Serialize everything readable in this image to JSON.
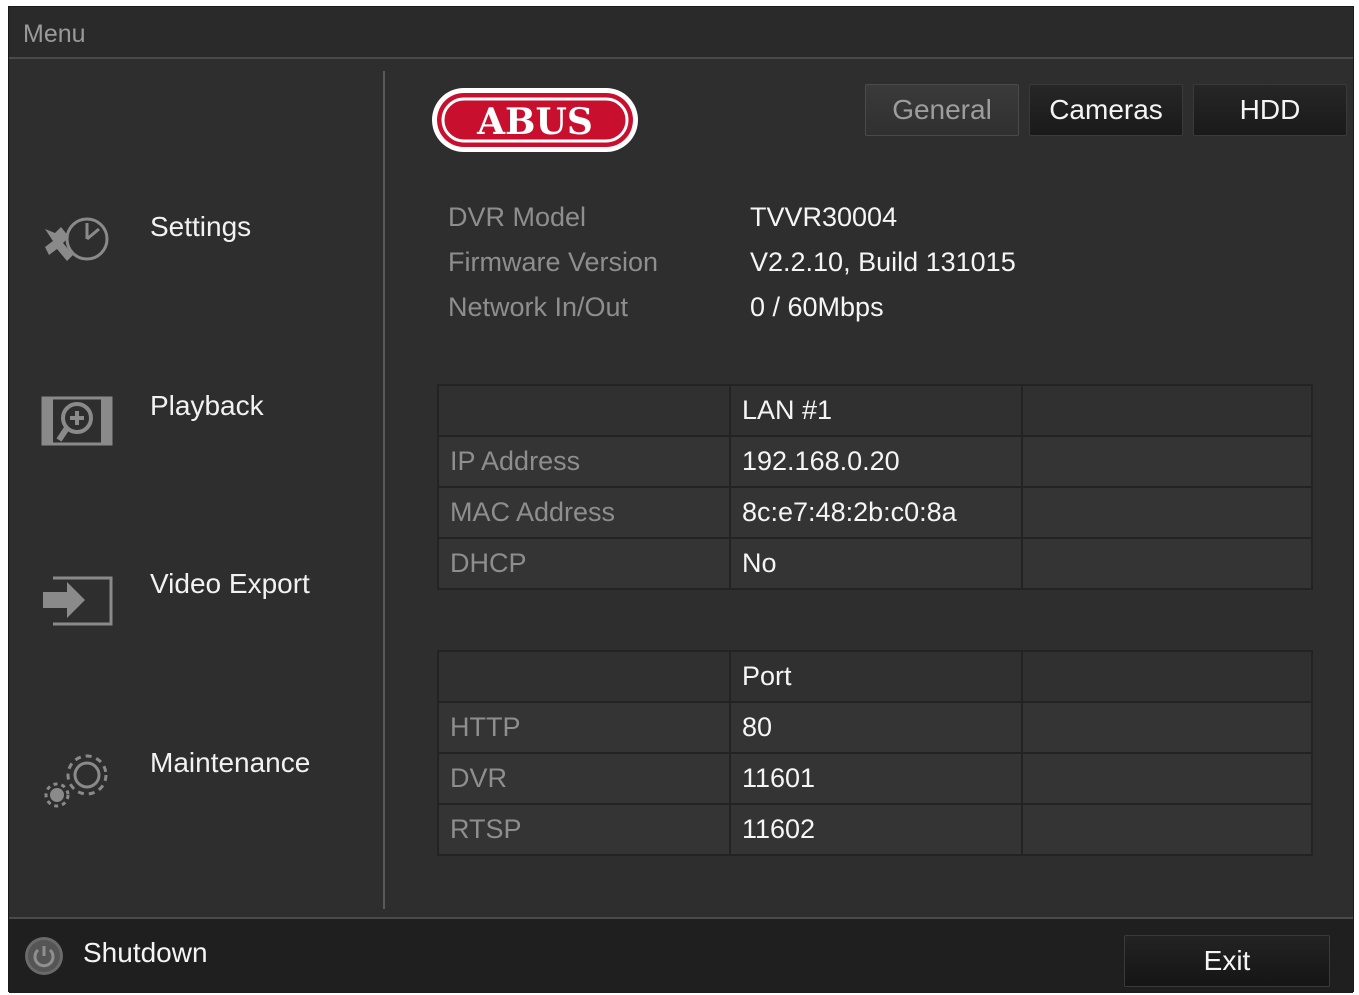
{
  "window": {
    "title": "Menu"
  },
  "brand": {
    "logo_text": "ABUS",
    "logo_color": "#c8102e"
  },
  "tabs": [
    {
      "label": "General",
      "active": true
    },
    {
      "label": "Cameras",
      "active": false
    },
    {
      "label": "HDD",
      "active": false
    }
  ],
  "sidebar": {
    "items": [
      {
        "label": "Settings",
        "icon": "settings-tools-icon"
      },
      {
        "label": "Playback",
        "icon": "playback-search-icon"
      },
      {
        "label": "Video Export",
        "icon": "video-export-icon"
      },
      {
        "label": "Maintenance",
        "icon": "maintenance-gears-icon"
      }
    ]
  },
  "info": {
    "dvr_model": {
      "label": "DVR Model",
      "value": "TVVR30004"
    },
    "firmware": {
      "label": "Firmware Version",
      "value": "V2.2.10, Build 131015"
    },
    "network": {
      "label": "Network In/Out",
      "value": "0 / 60Mbps"
    }
  },
  "lan_table": {
    "header": "LAN #1",
    "rows": [
      {
        "label": "IP Address",
        "value": "192.168.0.20"
      },
      {
        "label": "MAC Address",
        "value": "8c:e7:48:2b:c0:8a"
      },
      {
        "label": "DHCP",
        "value": "No"
      }
    ]
  },
  "port_table": {
    "header": "Port",
    "rows": [
      {
        "label": "HTTP",
        "value": "80"
      },
      {
        "label": "DVR",
        "value": "11601"
      },
      {
        "label": "RTSP",
        "value": "11602"
      }
    ]
  },
  "footer": {
    "shutdown_label": "Shutdown",
    "exit_label": "Exit"
  }
}
